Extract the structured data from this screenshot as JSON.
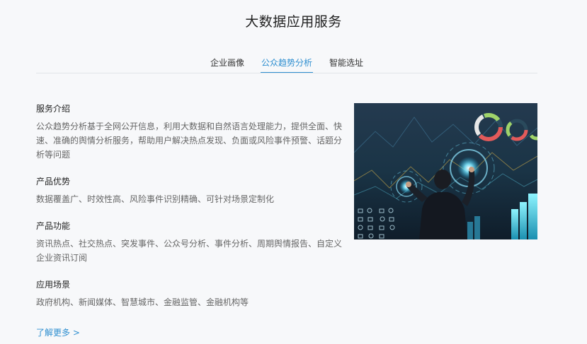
{
  "page": {
    "title": "大数据应用服务"
  },
  "tabs": [
    {
      "label": "企业画像",
      "active": false
    },
    {
      "label": "公众趋势分析",
      "active": true
    },
    {
      "label": "智能选址",
      "active": false
    }
  ],
  "sections": [
    {
      "title": "服务介绍",
      "text": "公众趋势分析基于全网公开信息，利用大数据和自然语言处理能力，提供全面、快速、准确的舆情分析服务，帮助用户解决热点发现、负面或风险事件预警、话题分析等问题"
    },
    {
      "title": "产品优势",
      "text": "数据覆盖广、时效性高、风险事件识别精确、可针对场景定制化"
    },
    {
      "title": "产品功能",
      "text": "资讯热点、社交热点、突发事件、公众号分析、事件分析、周期舆情报告、自定义企业资讯订阅"
    },
    {
      "title": "应用场景",
      "text": "政府机构、新闻媒体、智慧城市、金融监管、金融机构等"
    }
  ],
  "more_link": "了解更多 >",
  "colors": {
    "accent": "#2f8fd0",
    "background": "#f7f8fa"
  }
}
